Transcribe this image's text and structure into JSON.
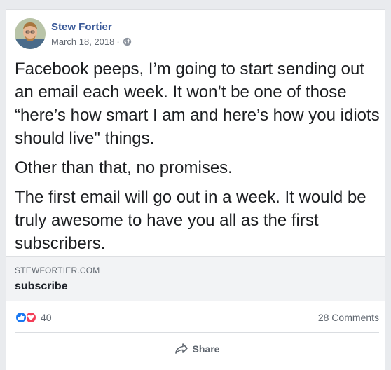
{
  "post": {
    "author": "Stew Fortier",
    "date": "March 18, 2018",
    "separator": "·",
    "privacy_icon": "globe-icon",
    "paragraphs": [
      "Facebook peeps, I’m going to start sending out an email each week. It won’t be one of those “here’s how smart I am and here’s how you idiots should live\" things.",
      "Other than that, no promises.",
      "The first email will go out in a week. It would be truly awesome to have you all as the first subscribers."
    ]
  },
  "link": {
    "domain": "STEWFORTIER.COM",
    "title": "subscribe"
  },
  "stats": {
    "reaction_icons": [
      "like-icon",
      "love-icon"
    ],
    "reaction_count": "40",
    "comments": "28 Comments"
  },
  "actions": {
    "share_label": "Share"
  },
  "colors": {
    "author": "#385898",
    "like": "#1877f2",
    "love": "#f33e58",
    "background": "#e9ebee"
  }
}
